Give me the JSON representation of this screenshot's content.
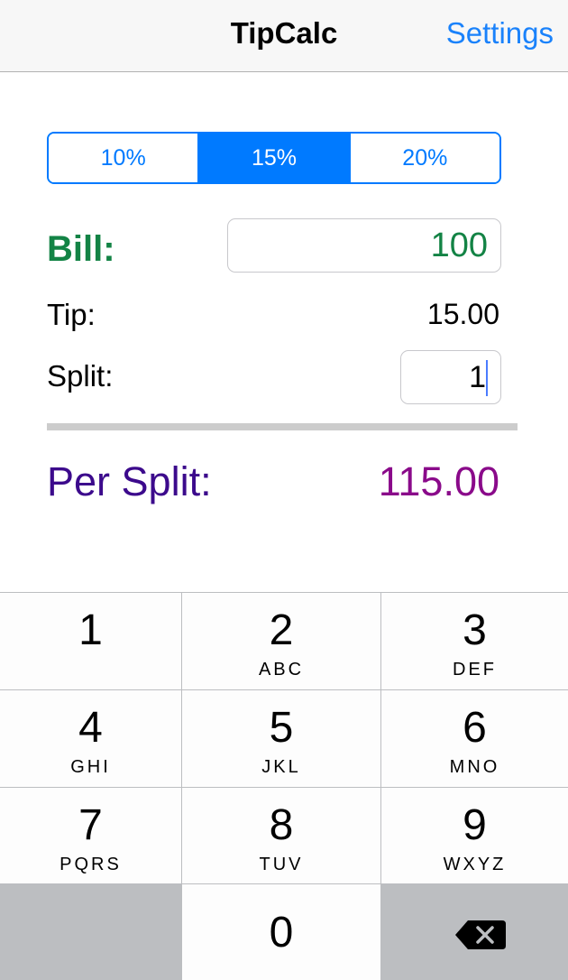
{
  "navbar": {
    "title": "TipCalc",
    "settings_label": "Settings"
  },
  "tip_segments": [
    {
      "label": "10%",
      "selected": false
    },
    {
      "label": "15%",
      "selected": true
    },
    {
      "label": "20%",
      "selected": false
    }
  ],
  "bill": {
    "label": "Bill:",
    "value": "100",
    "color": "#138345"
  },
  "tip": {
    "label": "Tip:",
    "value": "15.00"
  },
  "split": {
    "label": "Split:",
    "value": "1"
  },
  "per_split": {
    "label": "Per Split:",
    "value": "115.00",
    "label_color": "#3c0a8c",
    "value_color": "#8a0a8a"
  },
  "keypad": {
    "keys": [
      {
        "digit": "1",
        "letters": ""
      },
      {
        "digit": "2",
        "letters": "ABC"
      },
      {
        "digit": "3",
        "letters": "DEF"
      },
      {
        "digit": "4",
        "letters": "GHI"
      },
      {
        "digit": "5",
        "letters": "JKL"
      },
      {
        "digit": "6",
        "letters": "MNO"
      },
      {
        "digit": "7",
        "letters": "PQRS"
      },
      {
        "digit": "8",
        "letters": "TUV"
      },
      {
        "digit": "9",
        "letters": "WXYZ"
      },
      {
        "digit": "0",
        "letters": ""
      }
    ],
    "backspace_icon": "backspace-icon"
  },
  "colors": {
    "accent": "#007aff",
    "nav_link": "#1a82fb"
  }
}
